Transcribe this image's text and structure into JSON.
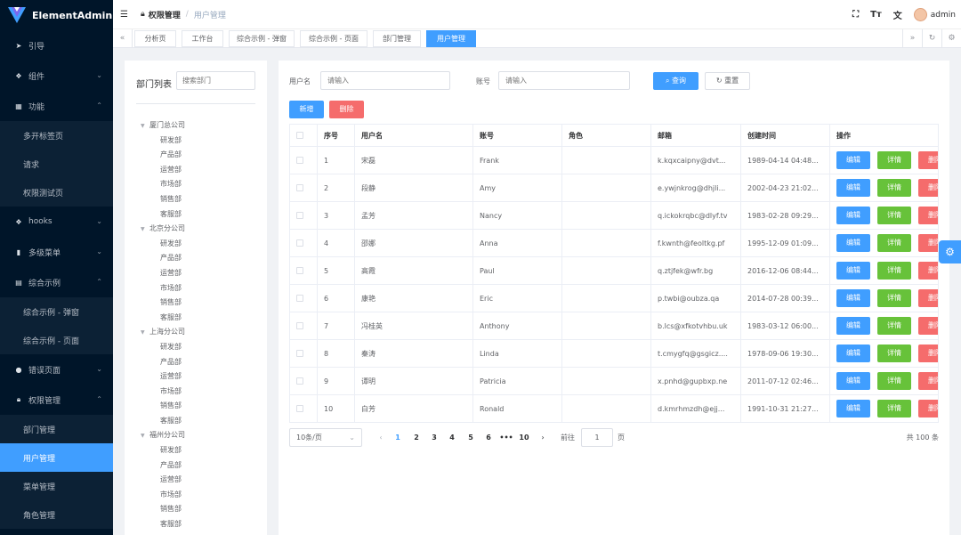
{
  "app": {
    "title": "ElementAdmin",
    "accent": "#409eff",
    "sidebar_bg": "#001529"
  },
  "sidebar": {
    "items": [
      {
        "label": "引导",
        "icon": "send-icon"
      },
      {
        "label": "组件",
        "icon": "cubes-icon"
      },
      {
        "label": "功能",
        "icon": "grid-icon"
      },
      {
        "label": "多开标签页"
      },
      {
        "label": "请求"
      },
      {
        "label": "权限测试页"
      },
      {
        "label": "hooks",
        "icon": "cubes-icon"
      },
      {
        "label": "多级菜单",
        "icon": "bar-chart-icon"
      },
      {
        "label": "综合示例",
        "icon": "bars-icon"
      },
      {
        "label": "综合示例 - 弹窗"
      },
      {
        "label": "综合示例 - 页面"
      },
      {
        "label": "错误页面",
        "icon": "alert-icon"
      },
      {
        "label": "权限管理",
        "icon": "lock-person-icon"
      },
      {
        "label": "部门管理"
      },
      {
        "label": "用户管理"
      },
      {
        "label": "菜单管理"
      },
      {
        "label": "角色管理"
      }
    ]
  },
  "header": {
    "breadcrumb": [
      "权限管理",
      "用户管理"
    ],
    "separator": "/",
    "username": "admin",
    "font_size_label": "Tт"
  },
  "tags": [
    {
      "label": "分析页"
    },
    {
      "label": "工作台"
    },
    {
      "label": "综合示例 - 弹窗"
    },
    {
      "label": "综合示例 - 页面"
    },
    {
      "label": "部门管理"
    },
    {
      "label": "用户管理",
      "active": true
    }
  ],
  "dept": {
    "title": "部门列表",
    "search_placeholder": "搜索部门",
    "tree": [
      {
        "name": "厦门总公司",
        "children": [
          "研发部",
          "产品部",
          "运营部",
          "市场部",
          "销售部",
          "客服部"
        ]
      },
      {
        "name": "北京分公司",
        "children": [
          "研发部",
          "产品部",
          "运营部",
          "市场部",
          "销售部",
          "客服部"
        ]
      },
      {
        "name": "上海分公司",
        "children": [
          "研发部",
          "产品部",
          "运营部",
          "市场部",
          "销售部",
          "客服部"
        ]
      },
      {
        "name": "福州分公司",
        "children": [
          "研发部",
          "产品部",
          "运营部",
          "市场部",
          "销售部",
          "客服部"
        ]
      }
    ]
  },
  "search": {
    "username_label": "用户名",
    "username_placeholder": "请输入",
    "account_label": "账号",
    "account_placeholder": "请输入",
    "query_label": "查询",
    "reset_label": "重置"
  },
  "toolbar": {
    "add_label": "新增",
    "delete_label": "删除"
  },
  "table": {
    "columns": [
      "序号",
      "用户名",
      "账号",
      "角色",
      "邮箱",
      "创建时间",
      "操作"
    ],
    "actions": {
      "edit": "编辑",
      "detail": "详情",
      "delete": "删除"
    },
    "rows": [
      {
        "index": "1",
        "name": "宋磊",
        "account": "Frank",
        "role": "",
        "email": "k.kqxcaipny@dvt...",
        "created": "1989-04-14 04:48..."
      },
      {
        "index": "2",
        "name": "段静",
        "account": "Amy",
        "role": "",
        "email": "e.ywjnkrog@dhjli...",
        "created": "2002-04-23 21:02..."
      },
      {
        "index": "3",
        "name": "孟芳",
        "account": "Nancy",
        "role": "",
        "email": "q.ickokrqbc@dlyf.tv",
        "created": "1983-02-28 09:29..."
      },
      {
        "index": "4",
        "name": "邵娜",
        "account": "Anna",
        "role": "",
        "email": "f.kwnth@feoltkg.pf",
        "created": "1995-12-09 01:09..."
      },
      {
        "index": "5",
        "name": "高霞",
        "account": "Paul",
        "role": "",
        "email": "q.ztjfek@wfr.bg",
        "created": "2016-12-06 08:44..."
      },
      {
        "index": "6",
        "name": "康艳",
        "account": "Eric",
        "role": "",
        "email": "p.twbi@oubza.qa",
        "created": "2014-07-28 00:39..."
      },
      {
        "index": "7",
        "name": "冯桂英",
        "account": "Anthony",
        "role": "",
        "email": "b.lcs@xfkotvhbu.uk",
        "created": "1983-03-12 06:00..."
      },
      {
        "index": "8",
        "name": "秦涛",
        "account": "Linda",
        "role": "",
        "email": "t.cmygfq@gsgicz....",
        "created": "1978-09-06 19:30..."
      },
      {
        "index": "9",
        "name": "谭明",
        "account": "Patricia",
        "role": "",
        "email": "x.pnhd@gupbxp.ne",
        "created": "2011-07-12 02:46..."
      },
      {
        "index": "10",
        "name": "白芳",
        "account": "Ronald",
        "role": "",
        "email": "d.kmrhmzdh@ejj...",
        "created": "1991-10-31 21:27..."
      }
    ]
  },
  "pagination": {
    "page_size": "10条/页",
    "pages": [
      "1",
      "2",
      "3",
      "4",
      "5",
      "6",
      "•••",
      "10"
    ],
    "current": "1",
    "goto_label": "前往",
    "goto_value": "1",
    "page_unit": "页",
    "total": "共 100 条"
  }
}
